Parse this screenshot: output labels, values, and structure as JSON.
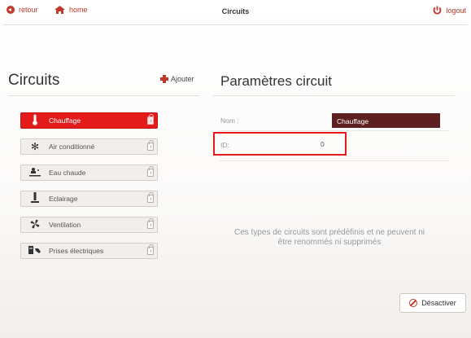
{
  "topbar": {
    "retour": "retour",
    "home": "home",
    "title": "Circuits",
    "logout": "logout"
  },
  "left": {
    "title": "Circuits",
    "add_label": "Ajouter",
    "items": [
      {
        "label": "Chauffage",
        "icon": "thermometer-icon",
        "active": true
      },
      {
        "label": "Air conditionné",
        "icon": "snowflake-icon",
        "active": false
      },
      {
        "label": "Eau chaude",
        "icon": "hot-water-icon",
        "active": false
      },
      {
        "label": "Eclairage",
        "icon": "lamp-icon",
        "active": false
      },
      {
        "label": "Ventilation",
        "icon": "fan-icon",
        "active": false
      },
      {
        "label": "Prises électriques",
        "icon": "plug-icon",
        "active": false
      }
    ]
  },
  "right": {
    "title": "Paramètres circuit",
    "nom_label": "Nom :",
    "nom_value": "Chauffage",
    "id_label": "ID:",
    "id_value": "0",
    "info": "Ces types de circuits sont prédéfinis et ne peuvent ni être renommés ni supprimés",
    "deactivate_label": "Désactiver"
  },
  "colors": {
    "accent": "#e31b1b",
    "name_field": "#5e1f20"
  }
}
